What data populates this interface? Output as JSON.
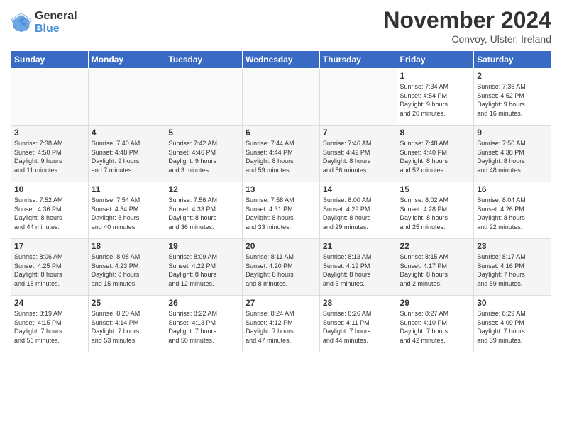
{
  "logo": {
    "general": "General",
    "blue": "Blue"
  },
  "title": "November 2024",
  "location": "Convoy, Ulster, Ireland",
  "headers": [
    "Sunday",
    "Monday",
    "Tuesday",
    "Wednesday",
    "Thursday",
    "Friday",
    "Saturday"
  ],
  "weeks": [
    {
      "days": [
        {
          "num": "",
          "info": "",
          "empty": true
        },
        {
          "num": "",
          "info": "",
          "empty": true
        },
        {
          "num": "",
          "info": "",
          "empty": true
        },
        {
          "num": "",
          "info": "",
          "empty": true
        },
        {
          "num": "",
          "info": "",
          "empty": true
        },
        {
          "num": "1",
          "info": "Sunrise: 7:34 AM\nSunset: 4:54 PM\nDaylight: 9 hours\nand 20 minutes."
        },
        {
          "num": "2",
          "info": "Sunrise: 7:36 AM\nSunset: 4:52 PM\nDaylight: 9 hours\nand 16 minutes."
        }
      ]
    },
    {
      "days": [
        {
          "num": "3",
          "info": "Sunrise: 7:38 AM\nSunset: 4:50 PM\nDaylight: 9 hours\nand 11 minutes."
        },
        {
          "num": "4",
          "info": "Sunrise: 7:40 AM\nSunset: 4:48 PM\nDaylight: 9 hours\nand 7 minutes."
        },
        {
          "num": "5",
          "info": "Sunrise: 7:42 AM\nSunset: 4:46 PM\nDaylight: 9 hours\nand 3 minutes."
        },
        {
          "num": "6",
          "info": "Sunrise: 7:44 AM\nSunset: 4:44 PM\nDaylight: 8 hours\nand 59 minutes."
        },
        {
          "num": "7",
          "info": "Sunrise: 7:46 AM\nSunset: 4:42 PM\nDaylight: 8 hours\nand 56 minutes."
        },
        {
          "num": "8",
          "info": "Sunrise: 7:48 AM\nSunset: 4:40 PM\nDaylight: 8 hours\nand 52 minutes."
        },
        {
          "num": "9",
          "info": "Sunrise: 7:50 AM\nSunset: 4:38 PM\nDaylight: 8 hours\nand 48 minutes."
        }
      ]
    },
    {
      "days": [
        {
          "num": "10",
          "info": "Sunrise: 7:52 AM\nSunset: 4:36 PM\nDaylight: 8 hours\nand 44 minutes."
        },
        {
          "num": "11",
          "info": "Sunrise: 7:54 AM\nSunset: 4:34 PM\nDaylight: 8 hours\nand 40 minutes."
        },
        {
          "num": "12",
          "info": "Sunrise: 7:56 AM\nSunset: 4:33 PM\nDaylight: 8 hours\nand 36 minutes."
        },
        {
          "num": "13",
          "info": "Sunrise: 7:58 AM\nSunset: 4:31 PM\nDaylight: 8 hours\nand 33 minutes."
        },
        {
          "num": "14",
          "info": "Sunrise: 8:00 AM\nSunset: 4:29 PM\nDaylight: 8 hours\nand 29 minutes."
        },
        {
          "num": "15",
          "info": "Sunrise: 8:02 AM\nSunset: 4:28 PM\nDaylight: 8 hours\nand 25 minutes."
        },
        {
          "num": "16",
          "info": "Sunrise: 8:04 AM\nSunset: 4:26 PM\nDaylight: 8 hours\nand 22 minutes."
        }
      ]
    },
    {
      "days": [
        {
          "num": "17",
          "info": "Sunrise: 8:06 AM\nSunset: 4:25 PM\nDaylight: 8 hours\nand 18 minutes."
        },
        {
          "num": "18",
          "info": "Sunrise: 8:08 AM\nSunset: 4:23 PM\nDaylight: 8 hours\nand 15 minutes."
        },
        {
          "num": "19",
          "info": "Sunrise: 8:09 AM\nSunset: 4:22 PM\nDaylight: 8 hours\nand 12 minutes."
        },
        {
          "num": "20",
          "info": "Sunrise: 8:11 AM\nSunset: 4:20 PM\nDaylight: 8 hours\nand 8 minutes."
        },
        {
          "num": "21",
          "info": "Sunrise: 8:13 AM\nSunset: 4:19 PM\nDaylight: 8 hours\nand 5 minutes."
        },
        {
          "num": "22",
          "info": "Sunrise: 8:15 AM\nSunset: 4:17 PM\nDaylight: 8 hours\nand 2 minutes."
        },
        {
          "num": "23",
          "info": "Sunrise: 8:17 AM\nSunset: 4:16 PM\nDaylight: 7 hours\nand 59 minutes."
        }
      ]
    },
    {
      "days": [
        {
          "num": "24",
          "info": "Sunrise: 8:19 AM\nSunset: 4:15 PM\nDaylight: 7 hours\nand 56 minutes."
        },
        {
          "num": "25",
          "info": "Sunrise: 8:20 AM\nSunset: 4:14 PM\nDaylight: 7 hours\nand 53 minutes."
        },
        {
          "num": "26",
          "info": "Sunrise: 8:22 AM\nSunset: 4:13 PM\nDaylight: 7 hours\nand 50 minutes."
        },
        {
          "num": "27",
          "info": "Sunrise: 8:24 AM\nSunset: 4:12 PM\nDaylight: 7 hours\nand 47 minutes."
        },
        {
          "num": "28",
          "info": "Sunrise: 8:26 AM\nSunset: 4:11 PM\nDaylight: 7 hours\nand 44 minutes."
        },
        {
          "num": "29",
          "info": "Sunrise: 8:27 AM\nSunset: 4:10 PM\nDaylight: 7 hours\nand 42 minutes."
        },
        {
          "num": "30",
          "info": "Sunrise: 8:29 AM\nSunset: 4:09 PM\nDaylight: 7 hours\nand 39 minutes."
        }
      ]
    }
  ]
}
